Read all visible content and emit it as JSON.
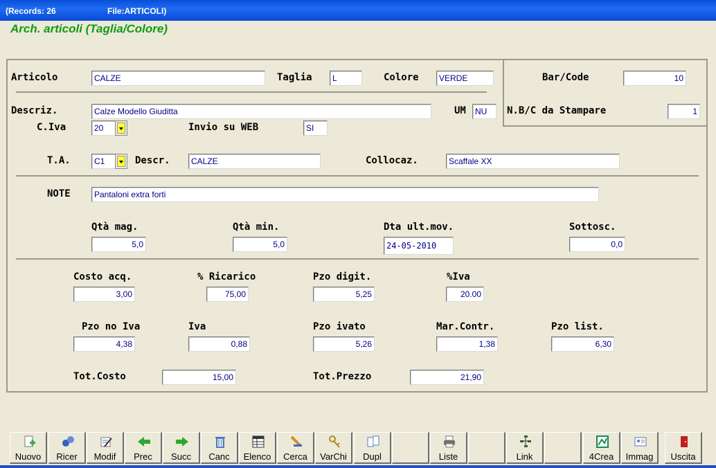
{
  "titlebar": {
    "records": "(Records: 26",
    "file": "File:ARTICOLI)"
  },
  "form_title": "Arch. articoli (Taglia/Colore)",
  "labels": {
    "articolo": "Articolo",
    "taglia": "Taglia",
    "colore": "Colore",
    "barcode": "Bar/Code",
    "nbc": "N.B/C da Stampare",
    "descriz": "Descriz.",
    "um": "UM",
    "civa": "C.Iva",
    "invio_web": "Invio su WEB",
    "ta": "T.A.",
    "descr": "Descr.",
    "collocaz": "Collocaz.",
    "note": "NOTE",
    "qta_mag": "Qtà mag.",
    "qta_min": "Qtà min.",
    "dta_ult_mov": "Dta ult.mov.",
    "sottosc": "Sottosc.",
    "costo_acq": "Costo acq.",
    "ricarico": "% Ricarico",
    "pzo_digit": "Pzo digit.",
    "perc_iva": "%Iva",
    "pzo_no_iva": "Pzo no Iva",
    "iva": "Iva",
    "pzo_ivato": "Pzo ivato",
    "mar_contr": "Mar.Contr.",
    "pzo_list": "Pzo list.",
    "tot_costo": "Tot.Costo",
    "tot_prezzo": "Tot.Prezzo"
  },
  "values": {
    "articolo": "CALZE",
    "taglia": "L",
    "colore": "VERDE",
    "barcode": "10",
    "nbc": "1",
    "descriz": "Calze Modello Giuditta",
    "um": "NU",
    "civa": "20",
    "invio_web": "SI",
    "ta": "C1",
    "descr": "CALZE",
    "collocaz": "Scaffale XX",
    "note": "Pantaloni extra forti",
    "qta_mag": "5,0",
    "qta_min": "5,0",
    "dta_ult_mov": "24-05-2010",
    "sottosc": "0,0",
    "costo_acq": "3,00",
    "ricarico": "75,00",
    "pzo_digit": "5,25",
    "perc_iva": "20.00",
    "pzo_no_iva": "4,38",
    "iva": "0,88",
    "pzo_ivato": "5,26",
    "mar_contr": "1,38",
    "pzo_list": "6,30",
    "tot_costo": "15,00",
    "tot_prezzo": "21,90"
  },
  "toolbar": [
    {
      "label": "Nuovo",
      "icon": "new-document-icon",
      "color": "#3aa83a"
    },
    {
      "label": "Ricer",
      "icon": "binoculars-icon",
      "color": "#3060c0"
    },
    {
      "label": "Modif",
      "icon": "edit-document-icon",
      "color": "#4070c0"
    },
    {
      "label": "Prec",
      "icon": "arrow-left-icon",
      "color": "#2fa82f"
    },
    {
      "label": "Succ",
      "icon": "arrow-right-icon",
      "color": "#2fa82f"
    },
    {
      "label": "Canc",
      "icon": "trash-icon",
      "color": "#4a7ac8"
    },
    {
      "label": "Elenco",
      "icon": "table-icon",
      "color": "#333333"
    },
    {
      "label": "Cerca",
      "icon": "search-pen-icon",
      "color": "#d09020"
    },
    {
      "label": "VarChi",
      "icon": "keys-icon",
      "color": "#b08a20"
    },
    {
      "label": "Dupl",
      "icon": "duplicate-icon",
      "color": "#5080c8"
    },
    {
      "label": "",
      "icon": "",
      "color": ""
    },
    {
      "label": "Liste",
      "icon": "printer-icon",
      "color": "#707070"
    },
    {
      "label": "",
      "icon": "",
      "color": ""
    },
    {
      "label": "Link",
      "icon": "tree-icon",
      "color": "#2a6a2a"
    },
    {
      "label": "",
      "icon": "",
      "color": ""
    },
    {
      "label": "4Crea",
      "icon": "drawing-icon",
      "color": "#1a8a5a"
    },
    {
      "label": "Immag",
      "icon": "image-card-icon",
      "color": "#5a7ab8"
    },
    {
      "label": "Uscita",
      "icon": "exit-door-icon",
      "color": "#c02020"
    }
  ]
}
